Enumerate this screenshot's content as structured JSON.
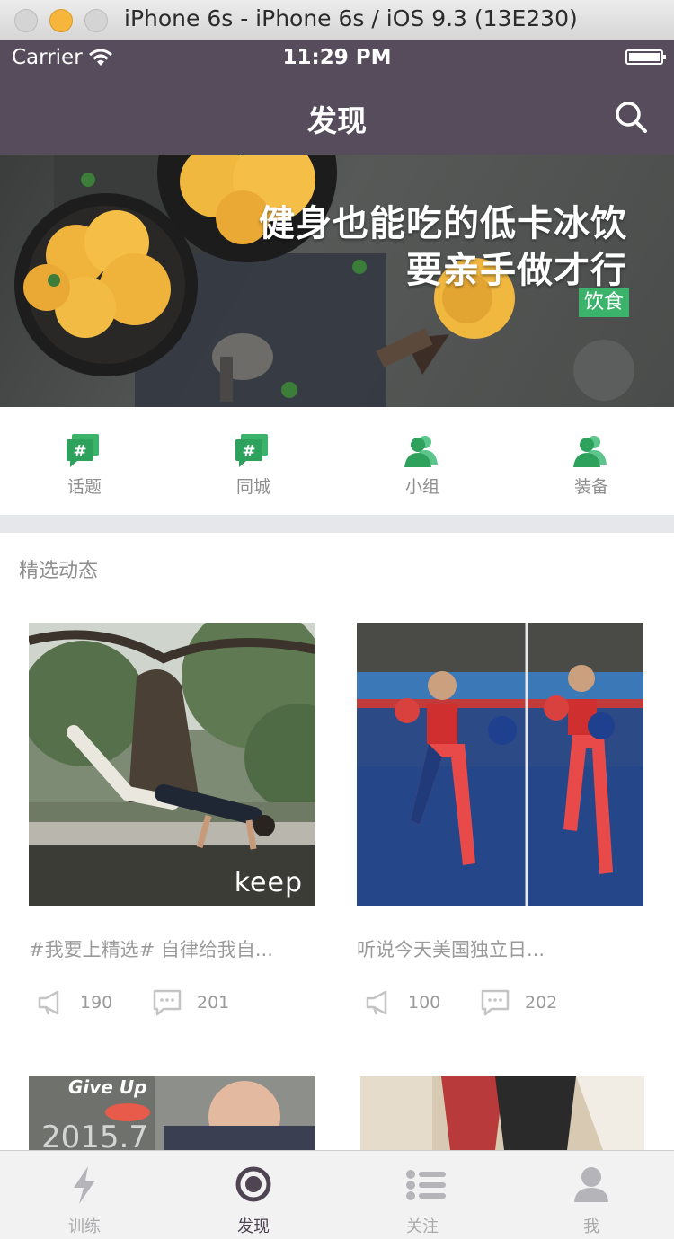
{
  "window": {
    "title": "iPhone 6s - iPhone 6s / iOS 9.3 (13E230)"
  },
  "status_bar": {
    "carrier": "Carrier",
    "time": "11:29 PM"
  },
  "nav": {
    "title": "发现",
    "search_icon": "search-icon"
  },
  "banner": {
    "line1": "健身也能吃的低卡冰饮",
    "line2": "要亲手做才行",
    "tag": "饮食"
  },
  "categories": [
    {
      "label": "话题",
      "icon": "hashtag-chat-icon"
    },
    {
      "label": "同城",
      "icon": "hashtag-chat-icon"
    },
    {
      "label": "小组",
      "icon": "group-icon"
    },
    {
      "label": "装备",
      "icon": "group-icon"
    }
  ],
  "feed": {
    "section_title": "精选动态",
    "cards": [
      {
        "caption": "#我要上精选# 自律给我自...",
        "likes": "190",
        "comments": "201",
        "watermark": "keep"
      },
      {
        "caption": "听说今天美国独立日...",
        "likes": "100",
        "comments": "202"
      }
    ],
    "partial_cards": [
      {
        "overlay_text": "Give Up",
        "year_text": "2015.7"
      },
      {}
    ]
  },
  "tabs": [
    {
      "label": "训练",
      "icon": "lightning-icon",
      "active": false
    },
    {
      "label": "发现",
      "icon": "discover-circle-icon",
      "active": true
    },
    {
      "label": "关注",
      "icon": "list-icon",
      "active": false
    },
    {
      "label": "我",
      "icon": "user-icon",
      "active": false
    }
  ],
  "colors": {
    "nav_bg": "#574c5b",
    "accent_green": "#3bb36b",
    "tab_active": "#4e4452",
    "tab_inactive": "#b5b4b8"
  }
}
